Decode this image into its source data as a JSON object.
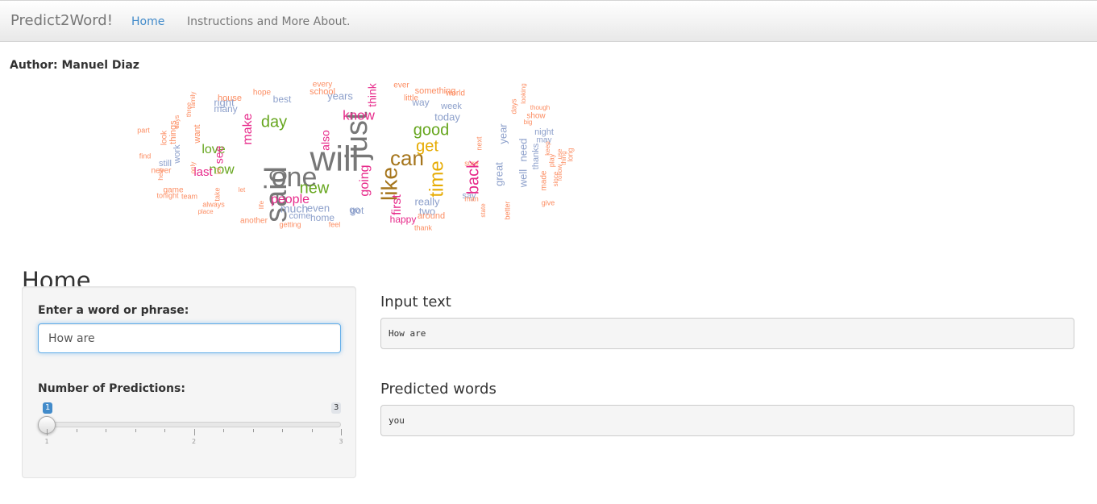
{
  "navbar": {
    "brand": "Predict2Word!",
    "tabs": [
      {
        "label": "Home",
        "active": true
      },
      {
        "label": "Instructions and More About.",
        "active": false
      }
    ],
    "active_color": "#428bca"
  },
  "author": "Author: Manuel Diaz",
  "wordcloud": {
    "words": [
      {
        "text": "will",
        "color": "#777777"
      },
      {
        "text": "said",
        "color": "#777777"
      },
      {
        "text": "one",
        "color": "#777777"
      },
      {
        "text": "just",
        "color": "#777777"
      },
      {
        "text": "like",
        "color": "#a6761d"
      },
      {
        "text": "can",
        "color": "#a6761d"
      },
      {
        "text": "time",
        "color": "#e6ab02"
      },
      {
        "text": "get",
        "color": "#e6ab02"
      },
      {
        "text": "good",
        "color": "#66a61e"
      },
      {
        "text": "day",
        "color": "#66a61e"
      },
      {
        "text": "new",
        "color": "#66a61e"
      },
      {
        "text": "now",
        "color": "#66a61e"
      },
      {
        "text": "love",
        "color": "#66a61e"
      },
      {
        "text": "know",
        "color": "#e7298a"
      },
      {
        "text": "people",
        "color": "#e7298a"
      },
      {
        "text": "back",
        "color": "#e7298a"
      },
      {
        "text": "make",
        "color": "#e7298a"
      },
      {
        "text": "last",
        "color": "#e7298a"
      },
      {
        "text": "going",
        "color": "#e7298a"
      },
      {
        "text": "see",
        "color": "#e7298a"
      },
      {
        "text": "also",
        "color": "#e7298a"
      },
      {
        "text": "first",
        "color": "#e7298a"
      },
      {
        "text": "think",
        "color": "#e7298a"
      },
      {
        "text": "today",
        "color": "#8da0cb"
      },
      {
        "text": "really",
        "color": "#8da0cb"
      },
      {
        "text": "two",
        "color": "#8da0cb"
      },
      {
        "text": "years",
        "color": "#8da0cb"
      },
      {
        "text": "way",
        "color": "#8da0cb"
      },
      {
        "text": "right",
        "color": "#8da0cb"
      },
      {
        "text": "even",
        "color": "#8da0cb"
      },
      {
        "text": "need",
        "color": "#8da0cb"
      },
      {
        "text": "much",
        "color": "#8da0cb"
      },
      {
        "text": "well",
        "color": "#8da0cb"
      },
      {
        "text": "go",
        "color": "#8da0cb"
      },
      {
        "text": "year",
        "color": "#8da0cb"
      },
      {
        "text": "great",
        "color": "#8da0cb"
      },
      {
        "text": "home",
        "color": "#8da0cb"
      },
      {
        "text": "got",
        "color": "#8da0cb"
      },
      {
        "text": "come",
        "color": "#8da0cb"
      },
      {
        "text": "say",
        "color": "#8da0cb"
      },
      {
        "text": "work",
        "color": "#8da0cb"
      },
      {
        "text": "still",
        "color": "#8da0cb"
      },
      {
        "text": "thanks",
        "color": "#8da0cb"
      },
      {
        "text": "night",
        "color": "#8da0cb"
      },
      {
        "text": "may",
        "color": "#8da0cb"
      },
      {
        "text": "week",
        "color": "#8da0cb"
      },
      {
        "text": "best",
        "color": "#8da0cb"
      },
      {
        "text": "many",
        "color": "#8da0cb"
      },
      {
        "text": "happy",
        "color": "#e7298a"
      },
      {
        "text": "around",
        "color": "#fc8d62"
      },
      {
        "text": "every",
        "color": "#fc8d62"
      },
      {
        "text": "ever",
        "color": "#fc8d62"
      },
      {
        "text": "something",
        "color": "#fc8d62"
      },
      {
        "text": "hope",
        "color": "#fc8d62"
      },
      {
        "text": "school",
        "color": "#fc8d62"
      },
      {
        "text": "house",
        "color": "#fc8d62"
      },
      {
        "text": "little",
        "color": "#fc8d62"
      },
      {
        "text": "world",
        "color": "#fc8d62"
      },
      {
        "text": "want",
        "color": "#fc8d62"
      },
      {
        "text": "things",
        "color": "#fc8d62"
      },
      {
        "text": "part",
        "color": "#fc8d62"
      },
      {
        "text": "find",
        "color": "#fc8d62"
      },
      {
        "text": "never",
        "color": "#fc8d62"
      },
      {
        "text": "game",
        "color": "#fc8d62"
      },
      {
        "text": "tonight",
        "color": "#fc8d62"
      },
      {
        "text": "team",
        "color": "#fc8d62"
      },
      {
        "text": "always",
        "color": "#fc8d62"
      },
      {
        "text": "place",
        "color": "#fc8d62"
      },
      {
        "text": "another",
        "color": "#fc8d62"
      },
      {
        "text": "getting",
        "color": "#fc8d62"
      },
      {
        "text": "feel",
        "color": "#fc8d62"
      },
      {
        "text": "thank",
        "color": "#fc8d62"
      },
      {
        "text": "life",
        "color": "#fc8d62"
      },
      {
        "text": "take",
        "color": "#fc8d62"
      },
      {
        "text": "let",
        "color": "#fc8d62"
      },
      {
        "text": "show",
        "color": "#fc8d62"
      },
      {
        "text": "big",
        "color": "#fc8d62"
      },
      {
        "text": "though",
        "color": "#fc8d62"
      },
      {
        "text": "sure",
        "color": "#fc8d62"
      },
      {
        "text": "man",
        "color": "#fc8d62"
      },
      {
        "text": "made",
        "color": "#fc8d62"
      },
      {
        "text": "give",
        "color": "#fc8d62"
      },
      {
        "text": "better",
        "color": "#fc8d62"
      },
      {
        "text": "since",
        "color": "#fc8d62"
      },
      {
        "text": "look",
        "color": "#fc8d62"
      },
      {
        "text": "days",
        "color": "#fc8d62"
      },
      {
        "text": "looking",
        "color": "#fc8d62"
      },
      {
        "text": "state",
        "color": "#fc8d62"
      },
      {
        "text": "play",
        "color": "#fc8d62"
      },
      {
        "text": "long",
        "color": "#fc8d62"
      },
      {
        "text": "use",
        "color": "#fc8d62"
      },
      {
        "text": "next",
        "color": "#fc8d62"
      },
      {
        "text": "family",
        "color": "#fc8d62"
      },
      {
        "text": "three",
        "color": "#fc8d62"
      },
      {
        "text": "lol",
        "color": "#fc8d62"
      },
      {
        "text": "says",
        "color": "#fc8d62"
      },
      {
        "text": "help",
        "color": "#fc8d62"
      },
      {
        "text": "only",
        "color": "#fc8d62"
      },
      {
        "text": "follow",
        "color": "#fc8d62"
      },
      {
        "text": "thing",
        "color": "#fc8d62"
      },
      {
        "text": "keep",
        "color": "#fc8d62"
      }
    ]
  },
  "page_title": "Home",
  "sidebar": {
    "phrase_label": "Enter a word or phrase:",
    "phrase_value": "How are",
    "predictions_label": "Number of Predictions:",
    "slider": {
      "min": 1,
      "max": 3,
      "value": 1,
      "value_label": "1",
      "max_label": "3",
      "tick_labels": [
        "1",
        "2",
        "3"
      ]
    }
  },
  "main": {
    "input_heading": "Input text",
    "input_value": "How are",
    "predicted_heading": "Predicted words",
    "predicted_value": "you"
  }
}
